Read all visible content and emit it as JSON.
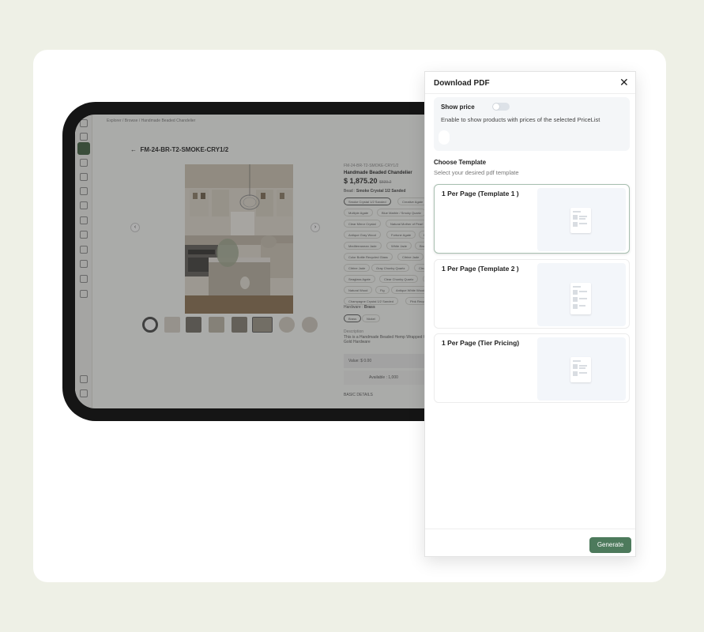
{
  "modal": {
    "title": "Download PDF",
    "close_icon": "close-icon",
    "show_price": {
      "label": "Show price",
      "enabled": false,
      "description": "Enable to show products with prices of the selected PriceList"
    },
    "choose_template": {
      "title": "Choose Template",
      "subtitle": "Select your desired pdf template"
    },
    "templates": [
      {
        "name": "1 Per Page (Template 1 )",
        "selected": true
      },
      {
        "name": "1 Per Page (Template 2 )",
        "selected": false
      },
      {
        "name": "1 Per Page (Tier Pricing)",
        "selected": false
      }
    ],
    "generate_label": "Generate",
    "accent_color": "#4d7a5c"
  },
  "background_app": {
    "breadcrumb": "Explorer  /  Browse  /  Handmade Beaded Chandelier",
    "product_code": "FM-24-BR-T2-SMOKE-CRY1/2",
    "sku": "FM-24-BR-T2-SMOKE-CRY1/2",
    "product_name": "Handmade Beaded Chandelier",
    "price": "$ 1,875.20",
    "old_price": "$839.2",
    "finish_label": "Bead :",
    "finish_value": "Smoke Crystal 1/2 Sanded",
    "bead_options": [
      "Smoke Crystal 1/2 Sanded",
      "Creative Agate",
      "Bl",
      "Multiple Agate",
      "Blue Marble / Smoky Quartz",
      "Clear Mirror Crystal",
      "Natural Mother of Pearl",
      "Antique Gray Wood",
      "Fortune Agate",
      "Dream",
      "Mediterranean Jade",
      "White Jade",
      "Bronze Pe",
      "Color Bottle Recycled Glass",
      "Citrine Jade",
      "Fan",
      "Citrine Jade",
      "Gray Chunky Quartz",
      "Clear Flan",
      "Seaglass Agate",
      "Clear Chunky Quartz",
      "Turq",
      "Natural Wood",
      "Fig",
      "Antique White Wood",
      "Champagne Crystal 1/2 Sanded",
      "Pink Recycled"
    ],
    "hardware_label": "Hardware :",
    "hardware_value": "Brass",
    "hardware_options": [
      "Brass",
      "Nickel"
    ],
    "description_label": "Description",
    "description_text": "This is a Handmade Beaded Hemp Wrapped Chandelier at Gold Hardware",
    "value_label": "Value: $ 0.00",
    "available_label": "Available : 1,000",
    "basic_details": "BASIC DETAILS"
  }
}
